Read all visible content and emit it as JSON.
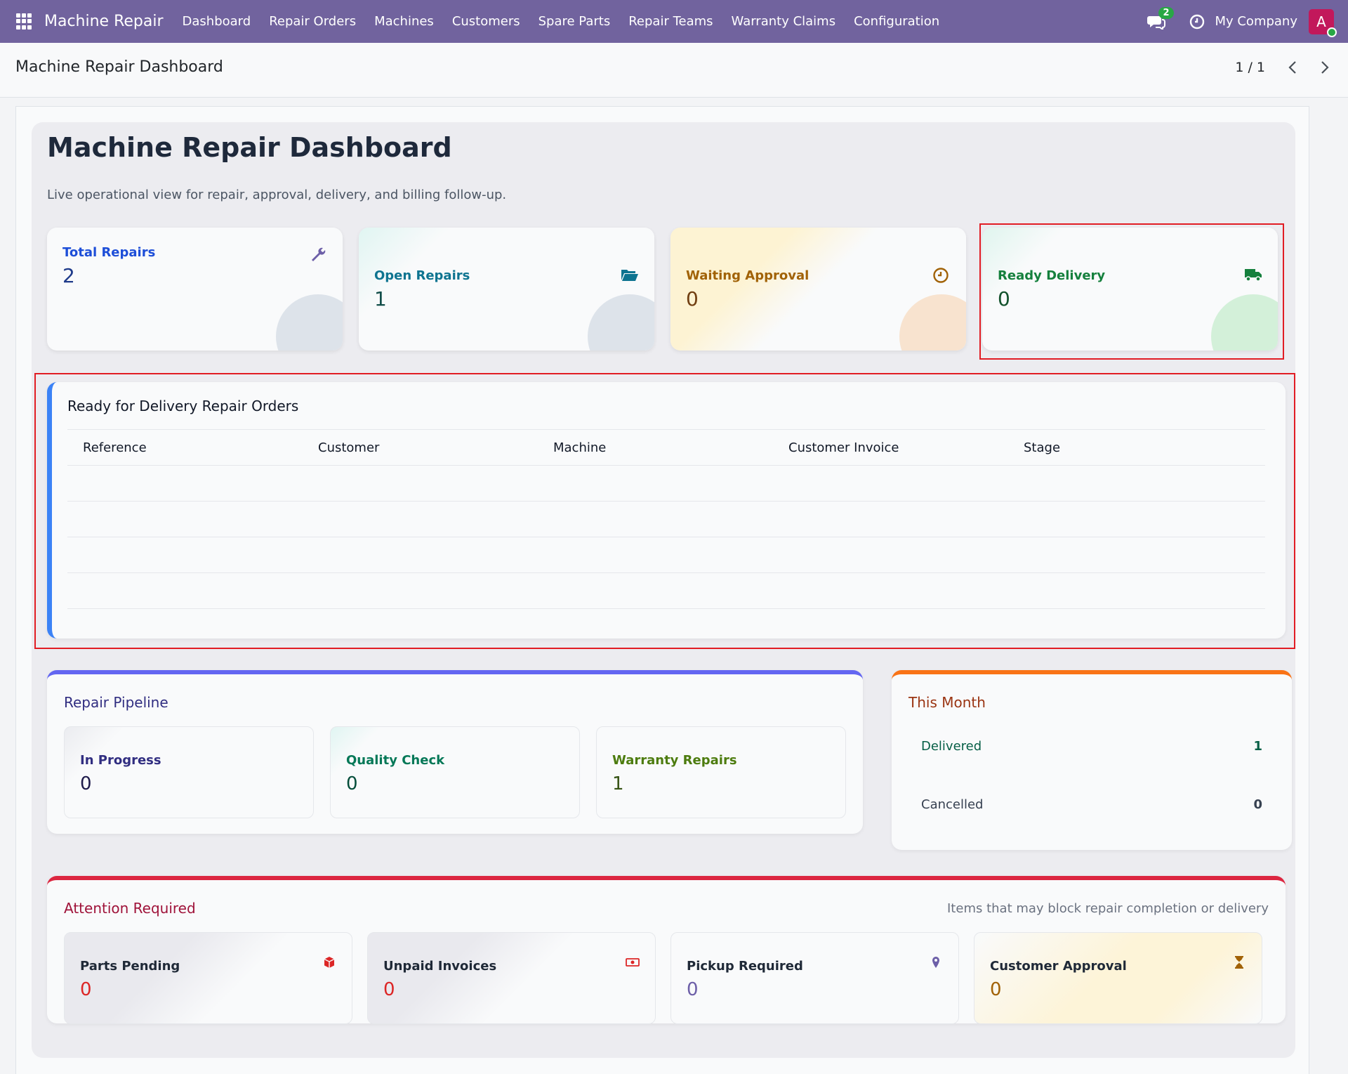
{
  "navbar": {
    "brand": "Machine Repair",
    "menu": [
      "Dashboard",
      "Repair Orders",
      "Machines",
      "Customers",
      "Spare Parts",
      "Repair Teams",
      "Warranty Claims",
      "Configuration"
    ],
    "chat_count": "2",
    "company": "My Company",
    "avatar_letter": "A",
    "bg_color": "#71639e"
  },
  "control": {
    "breadcrumb": "Machine Repair Dashboard",
    "pager": "1 / 1"
  },
  "dashboard": {
    "title": "Machine Repair Dashboard",
    "subtitle": "Live operational view for repair, approval, delivery, and billing follow-up.",
    "kpis": [
      {
        "label": "Total Repairs",
        "value": "2",
        "icon": "wrench-icon",
        "color": "#1d4ed8"
      },
      {
        "label": "Open Repairs",
        "value": "1",
        "icon": "folder-open-icon",
        "color": "#0e7490"
      },
      {
        "label": "Waiting Approval",
        "value": "0",
        "icon": "clock-icon",
        "color": "#a16207"
      },
      {
        "label": "Ready Delivery",
        "value": "0",
        "icon": "truck-icon",
        "color": "#15803d"
      }
    ],
    "ready_table": {
      "title": "Ready for Delivery Repair Orders",
      "columns": [
        "Reference",
        "Customer",
        "Machine",
        "Customer Invoice",
        "Stage"
      ],
      "rows": []
    },
    "pipeline": {
      "title": "Repair Pipeline",
      "items": [
        {
          "label": "In Progress",
          "value": "0",
          "color": "#312e81"
        },
        {
          "label": "Quality Check",
          "value": "0",
          "color": "#047857"
        },
        {
          "label": "Warranty Repairs",
          "value": "1",
          "color": "#4d7c0f"
        }
      ]
    },
    "this_month": {
      "title": "This Month",
      "rows": [
        {
          "label": "Delivered",
          "value": "1"
        },
        {
          "label": "Cancelled",
          "value": "0"
        }
      ]
    },
    "attention": {
      "title": "Attention Required",
      "note": "Items that may block repair completion or delivery",
      "items": [
        {
          "label": "Parts Pending",
          "value": "0",
          "icon": "box-icon",
          "color": "#dc2626"
        },
        {
          "label": "Unpaid Invoices",
          "value": "0",
          "icon": "money-icon",
          "color": "#dc2626"
        },
        {
          "label": "Pickup Required",
          "value": "0",
          "icon": "map-pin-icon",
          "color": "#6d5fa8"
        },
        {
          "label": "Customer Approval",
          "value": "0",
          "icon": "hourglass-icon",
          "color": "#a16207"
        }
      ]
    }
  }
}
